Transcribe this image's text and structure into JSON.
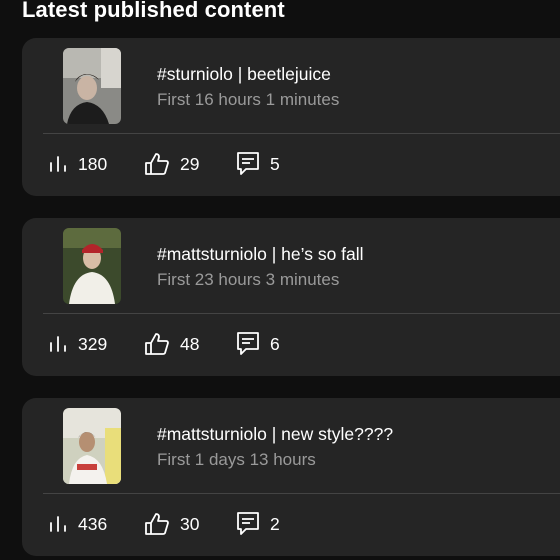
{
  "section": {
    "title": "Latest published content"
  },
  "colors": {
    "background": "#0f0f0f",
    "card": "#252525",
    "muted": "#9a9a9a"
  },
  "icons": {
    "views": "bar-chart-icon",
    "likes": "thumbs-up-icon",
    "comments": "comment-icon"
  },
  "posts": [
    {
      "title": "#sturniolo | beetlejuice",
      "subtitle": "First 16 hours 1 minutes",
      "views": "180",
      "likes": "29",
      "comments": "5"
    },
    {
      "title": "#mattsturniolo | he’s so fall",
      "subtitle": "First 23 hours 3 minutes",
      "views": "329",
      "likes": "48",
      "comments": "6"
    },
    {
      "title": "#mattsturniolo | new style????",
      "subtitle": "First 1 days 13 hours",
      "views": "436",
      "likes": "30",
      "comments": "2"
    }
  ]
}
